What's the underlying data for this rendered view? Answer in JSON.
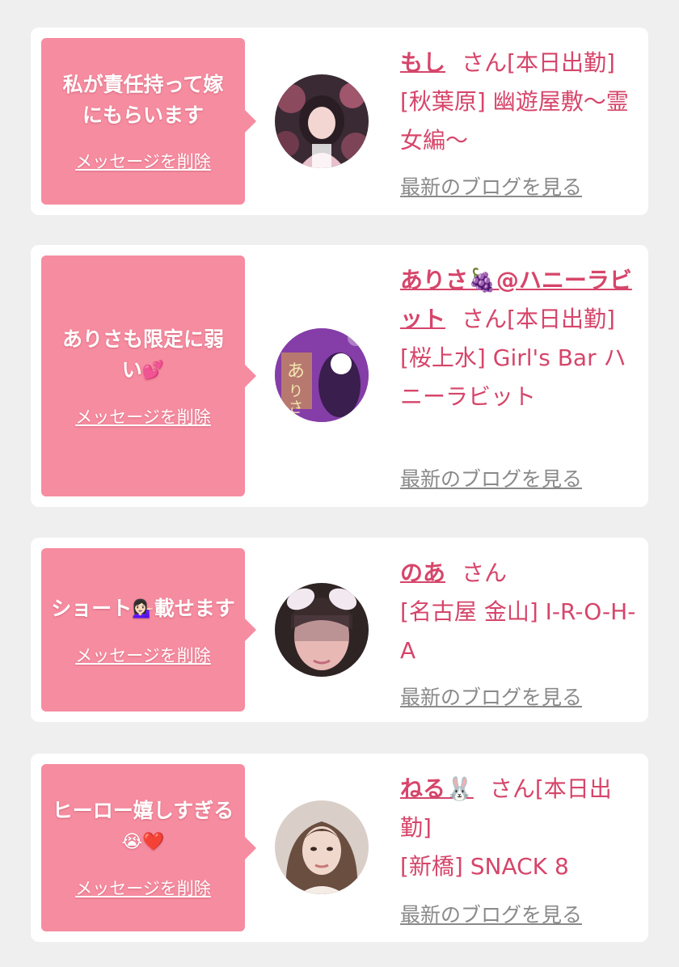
{
  "messages": [
    {
      "message": "私が責任持って嫁にもらいます",
      "delete_label": "メッセージを削除",
      "name": "もし",
      "san_status": "さん[本日出勤]",
      "shop": "[秋葉原] 幽遊屋敷〜霊女編〜",
      "blog_label": "最新のブログを見る"
    },
    {
      "message": "ありさも限定に弱い",
      "message_emoji": "💕",
      "delete_label": "メッセージを削除",
      "name": "ありさ🍇@ハニーラビット",
      "san_status": "さん[本日出勤]",
      "shop": "[桜上水] Girl's Bar ハニーラビット",
      "blog_label": "最新のブログを見る"
    },
    {
      "message_a": "ショート",
      "message_emoji": "💁🏻‍♀️",
      "message_b": "載せます",
      "delete_label": "メッセージを削除",
      "name": "のあ",
      "san_status": "さん",
      "shop": "[名古屋 金山] I-R-O-H-A",
      "blog_label": "最新のブログを見る"
    },
    {
      "message": "ヒーロー嬉しすぎる",
      "message_emoji": "😭❤️",
      "delete_label": "メッセージを削除",
      "name": "ねる🐰",
      "san_status": "さん[本日出勤]",
      "shop": "[新橋] SNACK 8",
      "blog_label": "最新のブログを見る"
    }
  ],
  "colors": {
    "page_background": "#efeff0",
    "bubble": "#f68ca0",
    "accent_text": "#d6456a",
    "blog_link": "#8a8a8a"
  }
}
